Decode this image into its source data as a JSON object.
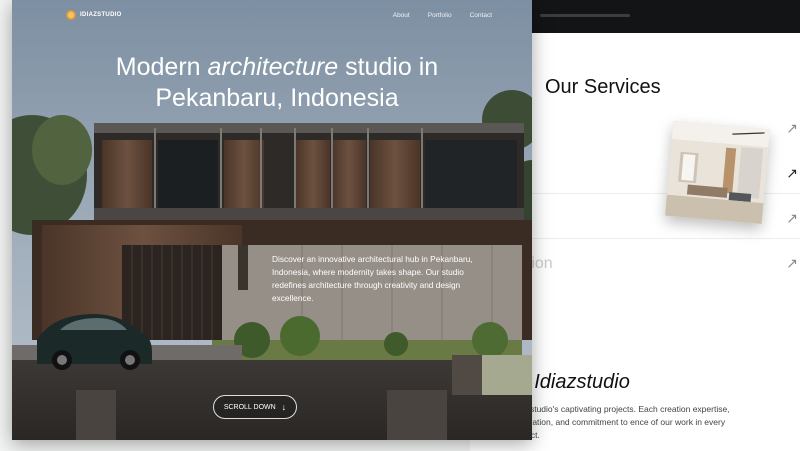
{
  "nav": {
    "brand": "IDIAZSTUDIO",
    "links": [
      "About",
      "Portfolio",
      "Contact"
    ]
  },
  "hero": {
    "headline_pre": "Modern ",
    "headline_em": "architecture",
    "headline_post": " studio in",
    "headline_line2": "Pekanbaru, Indonesia",
    "description": "Discover an innovative architectural hub in Pekanbaru, Indonesia, where modernity takes shape. Our studio redefines architecture through creativity and design excellence.",
    "scroll_label": "SCROLL DOWN",
    "scroll_icon": "arrow-down-icon"
  },
  "services": {
    "title": "Our Services",
    "faded_item": "ection",
    "arrow_icon": "arrow-up-right-icon",
    "arrow_glyph": "↗"
  },
  "projects": {
    "title_pre": "of ",
    "title_em": "Idiazstudio",
    "description": "Idiazstudio's captivating projects. Each creation expertise, innovation, and commitment to ence of our work in every project."
  }
}
